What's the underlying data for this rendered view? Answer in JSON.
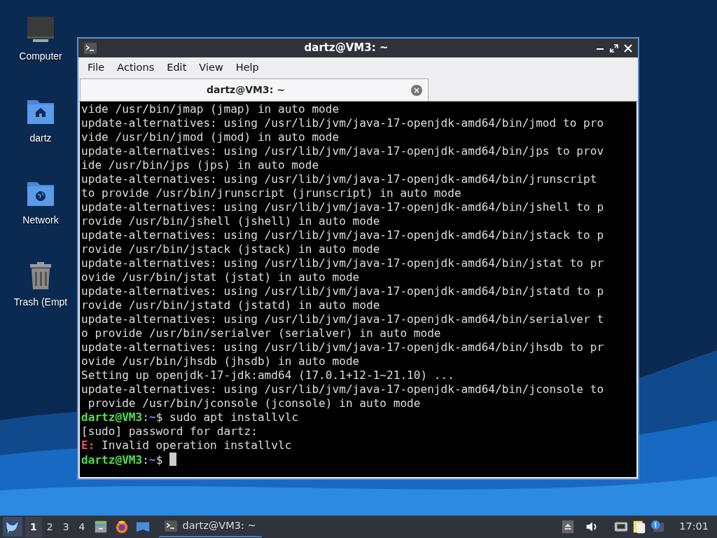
{
  "desktop_icons": [
    {
      "label": "Computer",
      "kind": "computer"
    },
    {
      "label": "dartz",
      "kind": "home"
    },
    {
      "label": "Network",
      "kind": "network"
    },
    {
      "label": "Trash (Empt",
      "kind": "trash"
    }
  ],
  "window": {
    "title": "dartz@VM3: ~",
    "menu": [
      "File",
      "Actions",
      "Edit",
      "View",
      "Help"
    ],
    "tabs": [
      {
        "label": "dartz@VM3: ~",
        "selected": true
      }
    ],
    "terminal": {
      "cursor": true,
      "lines": [
        [
          {
            "text": "vide /usr/bin/jmap (jmap) in auto mode",
            "kind": "plain"
          }
        ],
        [
          {
            "text": "update-alternatives: using /usr/lib/jvm/java-17-openjdk-amd64/bin/jmod to pro",
            "kind": "plain"
          }
        ],
        [
          {
            "text": "vide /usr/bin/jmod (jmod) in auto mode",
            "kind": "plain"
          }
        ],
        [
          {
            "text": "update-alternatives: using /usr/lib/jvm/java-17-openjdk-amd64/bin/jps to prov",
            "kind": "plain"
          }
        ],
        [
          {
            "text": "ide /usr/bin/jps (jps) in auto mode",
            "kind": "plain"
          }
        ],
        [
          {
            "text": "update-alternatives: using /usr/lib/jvm/java-17-openjdk-amd64/bin/jrunscript",
            "kind": "plain"
          }
        ],
        [
          {
            "text": "to provide /usr/bin/jrunscript (jrunscript) in auto mode",
            "kind": "plain"
          }
        ],
        [
          {
            "text": "update-alternatives: using /usr/lib/jvm/java-17-openjdk-amd64/bin/jshell to p",
            "kind": "plain"
          }
        ],
        [
          {
            "text": "rovide /usr/bin/jshell (jshell) in auto mode",
            "kind": "plain"
          }
        ],
        [
          {
            "text": "update-alternatives: using /usr/lib/jvm/java-17-openjdk-amd64/bin/jstack to p",
            "kind": "plain"
          }
        ],
        [
          {
            "text": "rovide /usr/bin/jstack (jstack) in auto mode",
            "kind": "plain"
          }
        ],
        [
          {
            "text": "update-alternatives: using /usr/lib/jvm/java-17-openjdk-amd64/bin/jstat to pr",
            "kind": "plain"
          }
        ],
        [
          {
            "text": "ovide /usr/bin/jstat (jstat) in auto mode",
            "kind": "plain"
          }
        ],
        [
          {
            "text": "update-alternatives: using /usr/lib/jvm/java-17-openjdk-amd64/bin/jstatd to p",
            "kind": "plain"
          }
        ],
        [
          {
            "text": "rovide /usr/bin/jstatd (jstatd) in auto mode",
            "kind": "plain"
          }
        ],
        [
          {
            "text": "update-alternatives: using /usr/lib/jvm/java-17-openjdk-amd64/bin/serialver t",
            "kind": "plain"
          }
        ],
        [
          {
            "text": "o provide /usr/bin/serialver (serialver) in auto mode",
            "kind": "plain"
          }
        ],
        [
          {
            "text": "update-alternatives: using /usr/lib/jvm/java-17-openjdk-amd64/bin/jhsdb to pr",
            "kind": "plain"
          }
        ],
        [
          {
            "text": "ovide /usr/bin/jhsdb (jhsdb) in auto mode",
            "kind": "plain"
          }
        ],
        [
          {
            "text": "Setting up openjdk-17-jdk:amd64 (17.0.1+12-1~21.10) ...",
            "kind": "plain"
          }
        ],
        [
          {
            "text": "update-alternatives: using /usr/lib/jvm/java-17-openjdk-amd64/bin/jconsole to",
            "kind": "plain"
          }
        ],
        [
          {
            "text": " provide /usr/bin/jconsole (jconsole) in auto mode",
            "kind": "plain"
          }
        ],
        [
          {
            "text": "dartz@VM3",
            "kind": "user"
          },
          {
            "text": ":",
            "kind": "plain"
          },
          {
            "text": "~",
            "kind": "path"
          },
          {
            "text": "$ sudo apt installvlc",
            "kind": "plain"
          }
        ],
        [
          {
            "text": "[sudo] password for dartz:",
            "kind": "plain"
          }
        ],
        [
          {
            "text": "E:",
            "kind": "error"
          },
          {
            "text": " Invalid operation installvlc",
            "kind": "plain"
          }
        ],
        [
          {
            "text": "dartz@VM3",
            "kind": "user"
          },
          {
            "text": ":",
            "kind": "plain"
          },
          {
            "text": "~",
            "kind": "path"
          },
          {
            "text": "$ ",
            "kind": "plain"
          }
        ]
      ]
    }
  },
  "taskbar": {
    "workspaces": [
      {
        "label": "1",
        "selected": true
      },
      {
        "label": "2",
        "selected": false
      },
      {
        "label": "3",
        "selected": false
      },
      {
        "label": "4",
        "selected": false
      }
    ],
    "tasks": [
      {
        "label": "dartz@VM3: ~",
        "selected": true
      }
    ],
    "clock": "17:01"
  }
}
